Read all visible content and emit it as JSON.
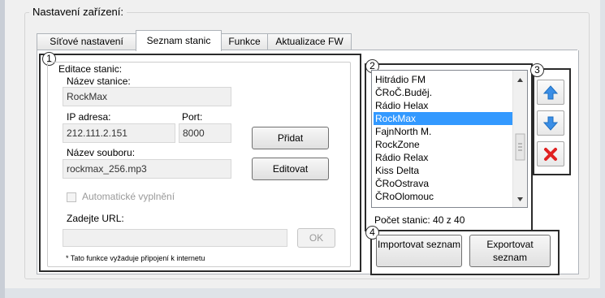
{
  "group_title": "Nastavení zařízení:",
  "tabs": [
    {
      "label": "Síťové nastavení"
    },
    {
      "label": "Seznam stanic"
    },
    {
      "label": "Funkce"
    },
    {
      "label": "Aktualizace FW"
    }
  ],
  "markers": {
    "m1": "1",
    "m2": "2",
    "m3": "3",
    "m4": "4"
  },
  "edit": {
    "legend": "Editace stanic:",
    "name_label": "Název stanice:",
    "name_value": "RockMax",
    "ip_label": "IP adresa:",
    "ip_value": "212.111.2.151",
    "port_label": "Port:",
    "port_value": "8000",
    "add_button": "Přidat",
    "file_label": "Název souboru:",
    "file_value": "rockmax_256.mp3",
    "edit_button": "Editovat",
    "auto_fill_label": "Automatické vyplnění",
    "url_label": "Zadejte URL:",
    "url_value": "",
    "ok_button": "OK",
    "footnote": "* Tato funkce vyžaduje připojení k internetu"
  },
  "stations": {
    "items": [
      "Hitrádio FM",
      "ČRoČ.Buděj.",
      "Rádio Helax",
      "RockMax",
      "FajnNorth M.",
      "RockZone",
      "Rádio Relax",
      "Kiss Delta",
      "ČRoOstrava",
      "ČRoOlomouc"
    ],
    "selected_index": 3,
    "count_label": "Počet stanic: 40 z 40"
  },
  "side_buttons": {
    "up_icon": "arrow-up-icon",
    "down_icon": "arrow-down-icon",
    "delete_icon": "red-x-icon"
  },
  "colors": {
    "selection": "#3399ff",
    "arrow": "#3a8ee6",
    "delete": "#e02020"
  },
  "import_button": "Importovat seznam",
  "export_button": "Exportovat seznam"
}
